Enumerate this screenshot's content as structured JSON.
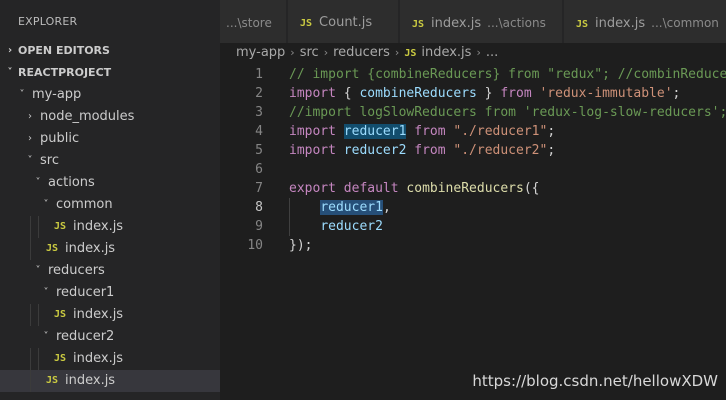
{
  "explorer": {
    "title": "EXPLORER",
    "open_editors": "OPEN EDITORS",
    "project": "REACTPROJECT",
    "tree": [
      {
        "label": "my-app",
        "type": "folder",
        "open": true,
        "depth": 1
      },
      {
        "label": "node_modules",
        "type": "folder",
        "open": false,
        "depth": 2
      },
      {
        "label": "public",
        "type": "folder",
        "open": false,
        "depth": 2
      },
      {
        "label": "src",
        "type": "folder",
        "open": true,
        "depth": 2
      },
      {
        "label": "actions",
        "type": "folder",
        "open": true,
        "depth": 3
      },
      {
        "label": "common",
        "type": "folder",
        "open": true,
        "depth": 4
      },
      {
        "label": "index.js",
        "type": "js",
        "depth": 5
      },
      {
        "label": "index.js",
        "type": "js",
        "depth": 4
      },
      {
        "label": "reducers",
        "type": "folder",
        "open": true,
        "depth": 3
      },
      {
        "label": "reducer1",
        "type": "folder",
        "open": true,
        "depth": 4
      },
      {
        "label": "index.js",
        "type": "js",
        "depth": 5
      },
      {
        "label": "reducer2",
        "type": "folder",
        "open": true,
        "depth": 4
      },
      {
        "label": "index.js",
        "type": "js",
        "depth": 5
      },
      {
        "label": "index.js",
        "type": "js",
        "depth": 4,
        "selected": true
      }
    ]
  },
  "icons": {
    "js": "JS",
    "chevron_right": "›",
    "chevron_down": "˅"
  },
  "tabs": [
    {
      "label": "",
      "desc": "...\\store",
      "js": false
    },
    {
      "label": "Count.js",
      "desc": "",
      "js": true
    },
    {
      "label": "index.js",
      "desc": "...\\actions",
      "js": true
    },
    {
      "label": "index.js",
      "desc": "...\\common",
      "js": true
    }
  ],
  "breadcrumb": [
    "my-app",
    "src",
    "reducers",
    "index.js",
    "..."
  ],
  "code": [
    {
      "n": "1",
      "tokens": [
        [
          "c",
          "// import {combineReducers} from \"redux\"; //combinReducers"
        ]
      ]
    },
    {
      "n": "2",
      "tokens": [
        [
          "k",
          "import"
        ],
        [
          "p",
          " { "
        ],
        [
          "v",
          "combineReducers"
        ],
        [
          "p",
          " } "
        ],
        [
          "k",
          "from"
        ],
        [
          "p",
          " "
        ],
        [
          "s",
          "'redux-immutable'"
        ],
        [
          "p",
          ";"
        ]
      ]
    },
    {
      "n": "3",
      "tokens": [
        [
          "c",
          "//import logSlowReducers from 'redux-log-slow-reducers';"
        ]
      ]
    },
    {
      "n": "4",
      "tokens": [
        [
          "k",
          "import"
        ],
        [
          "p",
          " "
        ],
        [
          "v hl2",
          "reducer1"
        ],
        [
          "p",
          " "
        ],
        [
          "k",
          "from"
        ],
        [
          "p",
          " "
        ],
        [
          "s",
          "\"./reducer1\""
        ],
        [
          "p",
          ";"
        ]
      ]
    },
    {
      "n": "5",
      "tokens": [
        [
          "k",
          "import"
        ],
        [
          "p",
          " "
        ],
        [
          "v",
          "reducer2"
        ],
        [
          "p",
          " "
        ],
        [
          "k",
          "from"
        ],
        [
          "p",
          " "
        ],
        [
          "s",
          "\"./reducer2\""
        ],
        [
          "p",
          ";"
        ]
      ]
    },
    {
      "n": "6",
      "tokens": []
    },
    {
      "n": "7",
      "tokens": [
        [
          "k",
          "export"
        ],
        [
          "p",
          " "
        ],
        [
          "k",
          "default"
        ],
        [
          "p",
          " "
        ],
        [
          "f",
          "combineReducers"
        ],
        [
          "p",
          "({"
        ]
      ]
    },
    {
      "n": "8",
      "tokens": [
        [
          "p",
          "    "
        ],
        [
          "v hl",
          "reducer1"
        ],
        [
          "p",
          ","
        ]
      ],
      "active": true,
      "guide": true
    },
    {
      "n": "9",
      "tokens": [
        [
          "p",
          "    "
        ],
        [
          "v",
          "reducer2"
        ]
      ],
      "guide": true
    },
    {
      "n": "10",
      "tokens": [
        [
          "p",
          "});"
        ]
      ]
    }
  ],
  "watermark": "https://blog.csdn.net/hellowXDW",
  "colors": {
    "sidebar": "#252526",
    "editor": "#1e1e1e",
    "selection": "#264f78",
    "js_icon": "#cbcb41"
  }
}
